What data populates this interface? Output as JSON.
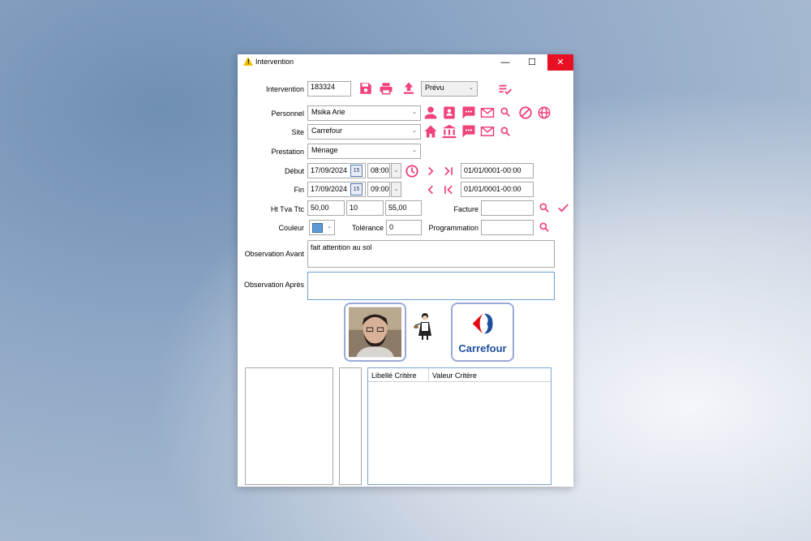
{
  "window": {
    "title": "Intervention",
    "minimize": "—",
    "maximize": "☐",
    "close": "✕"
  },
  "form": {
    "intervention_label": "Intervention",
    "intervention_value": "183324",
    "status_value": "Prévu",
    "personnel_label": "Personnel",
    "personnel_value": "Msika Arie",
    "site_label": "Site",
    "site_value": "Carrefour",
    "prestation_label": "Prestation",
    "prestation_value": "Ménage",
    "debut_label": "Début",
    "debut_date": "17/09/2024",
    "debut_time": "08:00",
    "debut_range": "01/01/0001-00:00",
    "fin_label": "Fin",
    "fin_date": "17/09/2024",
    "fin_time": "09:00",
    "fin_range": "01/01/0001-00:00",
    "httvattc_label": "Ht Tva Ttc",
    "ht_value": "50,00",
    "tva_value": "10",
    "ttc_value": "55,00",
    "facture_label": "Facture",
    "facture_value": "",
    "couleur_label": "Couleur",
    "tolerance_label": "Tolérance",
    "tolerance_value": "0",
    "programmation_label": "Programmation",
    "programmation_value": "",
    "obs_avant_label": "Observation Avant",
    "obs_avant_value": "fait attention au sol",
    "obs_apres_label": "Observation Après",
    "obs_apres_value": "",
    "calendar_day": "15",
    "criteria_col1": "Libellé Critère",
    "criteria_col2": "Valeur Critère"
  },
  "logo": {
    "carrefour_text": "Carrefour"
  },
  "colors": {
    "accent": "#f0437a",
    "close_red": "#e81123",
    "carrefour_blue": "#1e4f9e",
    "carrefour_red": "#e30613"
  }
}
